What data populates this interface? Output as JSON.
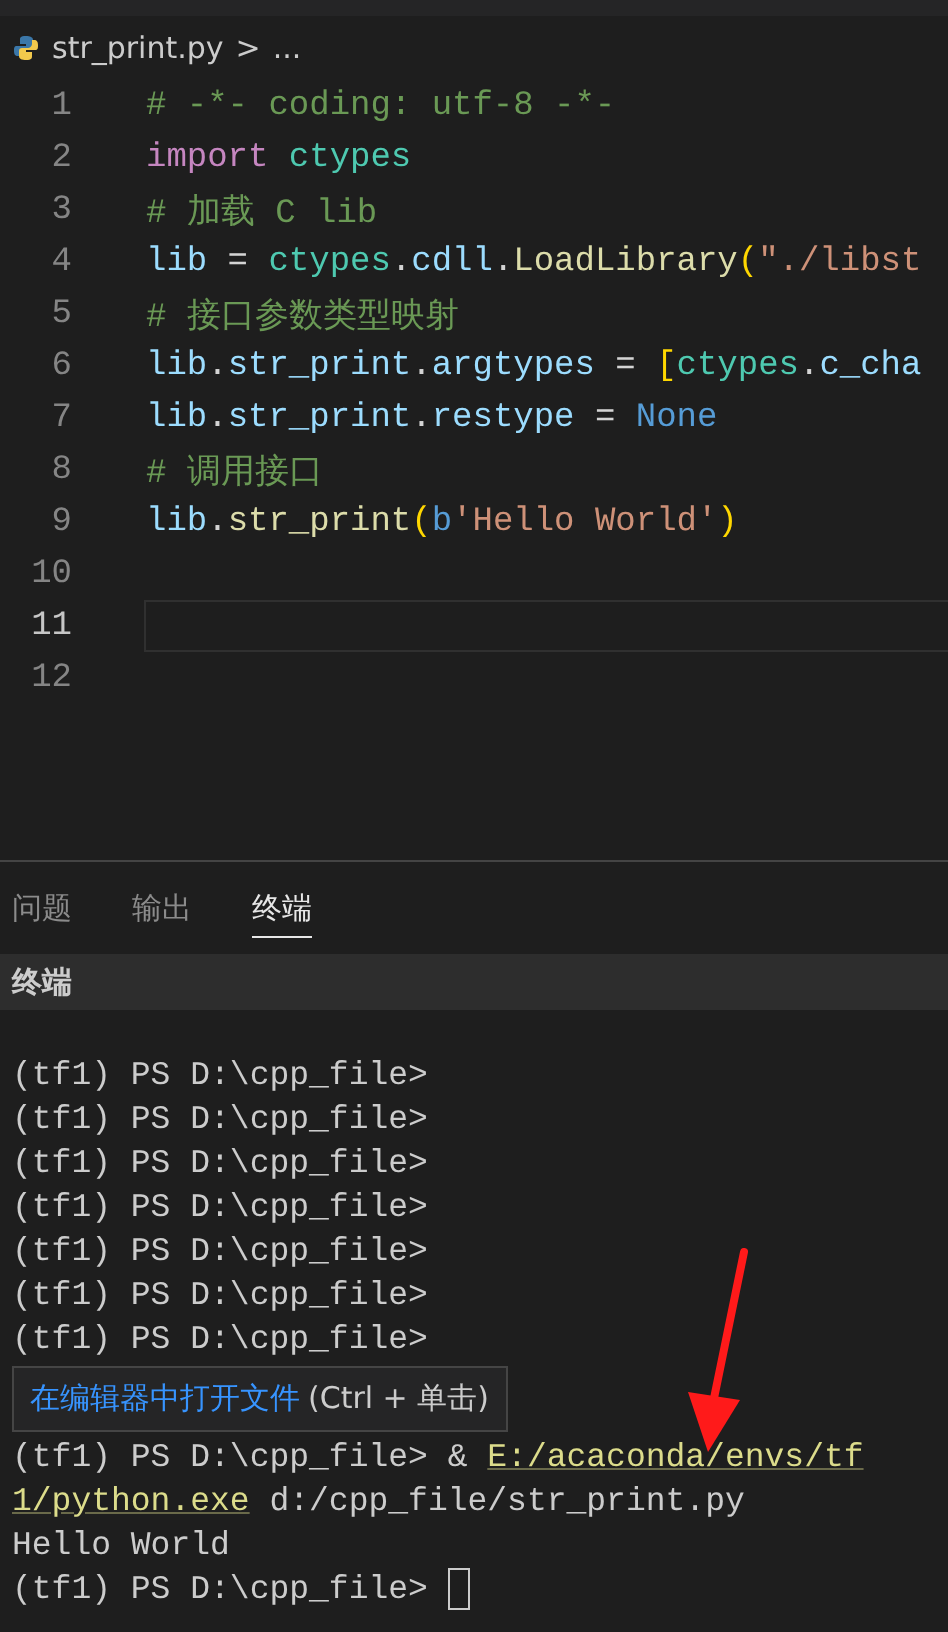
{
  "breadcrumb": {
    "file": "str_print.py",
    "separator": ">",
    "rest": "..."
  },
  "editor": {
    "lines": [
      {
        "number": "1",
        "current": false,
        "tokens": [
          {
            "kind": "comment",
            "text": "# -*- coding: utf-8 -*-"
          }
        ]
      },
      {
        "number": "2",
        "current": false,
        "tokens": [
          {
            "kind": "keyword",
            "text": "import "
          },
          {
            "kind": "module",
            "text": "ctypes"
          }
        ]
      },
      {
        "number": "3",
        "current": false,
        "tokens": [
          {
            "kind": "comment",
            "text": "# 加载 C lib"
          }
        ]
      },
      {
        "number": "4",
        "current": false,
        "tokens": [
          {
            "kind": "variable",
            "text": "lib"
          },
          {
            "kind": "plain",
            "text": " = "
          },
          {
            "kind": "module",
            "text": "ctypes"
          },
          {
            "kind": "plain",
            "text": "."
          },
          {
            "kind": "variable",
            "text": "cdll"
          },
          {
            "kind": "plain",
            "text": "."
          },
          {
            "kind": "function",
            "text": "LoadLibrary"
          },
          {
            "kind": "bracket",
            "text": "("
          },
          {
            "kind": "string",
            "text": "\"./libst"
          }
        ]
      },
      {
        "number": "5",
        "current": false,
        "tokens": [
          {
            "kind": "comment",
            "text": "# 接口参数类型映射"
          }
        ]
      },
      {
        "number": "6",
        "current": false,
        "tokens": [
          {
            "kind": "variable",
            "text": "lib"
          },
          {
            "kind": "plain",
            "text": "."
          },
          {
            "kind": "variable",
            "text": "str_print"
          },
          {
            "kind": "plain",
            "text": "."
          },
          {
            "kind": "variable",
            "text": "argtypes"
          },
          {
            "kind": "plain",
            "text": " = "
          },
          {
            "kind": "bracket",
            "text": "["
          },
          {
            "kind": "module",
            "text": "ctypes"
          },
          {
            "kind": "plain",
            "text": "."
          },
          {
            "kind": "variable",
            "text": "c_cha"
          }
        ]
      },
      {
        "number": "7",
        "current": false,
        "tokens": [
          {
            "kind": "variable",
            "text": "lib"
          },
          {
            "kind": "plain",
            "text": "."
          },
          {
            "kind": "variable",
            "text": "str_print"
          },
          {
            "kind": "plain",
            "text": "."
          },
          {
            "kind": "variable",
            "text": "restype"
          },
          {
            "kind": "plain",
            "text": " = "
          },
          {
            "kind": "constant",
            "text": "None"
          }
        ]
      },
      {
        "number": "8",
        "current": false,
        "tokens": [
          {
            "kind": "comment",
            "text": "# 调用接口"
          }
        ]
      },
      {
        "number": "9",
        "current": false,
        "tokens": [
          {
            "kind": "variable",
            "text": "lib"
          },
          {
            "kind": "plain",
            "text": "."
          },
          {
            "kind": "function",
            "text": "str_print"
          },
          {
            "kind": "bracket",
            "text": "("
          },
          {
            "kind": "constant",
            "text": "b"
          },
          {
            "kind": "string",
            "text": "'Hello World'"
          },
          {
            "kind": "bracket",
            "text": ")"
          }
        ]
      },
      {
        "number": "10",
        "current": false
      },
      {
        "number": "11",
        "current": true
      },
      {
        "number": "12",
        "current": false
      }
    ]
  },
  "panel_tabs": [
    {
      "label": "问题",
      "selected": false
    },
    {
      "label": "输出",
      "selected": false
    },
    {
      "label": "终端",
      "selected": true
    }
  ],
  "panel_header": "终端",
  "terminal": {
    "lines_before": [
      "(tf1) PS D:\\cpp_file>",
      "(tf1) PS D:\\cpp_file>",
      "(tf1) PS D:\\cpp_file>",
      "(tf1) PS D:\\cpp_file>",
      "(tf1) PS D:\\cpp_file>",
      "(tf1) PS D:\\cpp_file>",
      "(tf1) PS D:\\cpp_file>"
    ],
    "tooltip": {
      "link": "在编辑器中打开文件",
      "shortcut": "(Ctrl + 单击)"
    },
    "command": [
      [
        {
          "kind": "text",
          "text": "(tf1) PS D:\\cpp_file> & "
        },
        {
          "kind": "link",
          "text": "E:/acaconda/envs/tf"
        }
      ],
      [
        {
          "kind": "link",
          "text": "1/python.exe"
        },
        {
          "kind": "text",
          "text": " d:/cpp_file/str_print.py"
        }
      ]
    ],
    "lines_after": [
      "Hello World"
    ],
    "prompt": "(tf1) PS D:\\cpp_file> "
  }
}
